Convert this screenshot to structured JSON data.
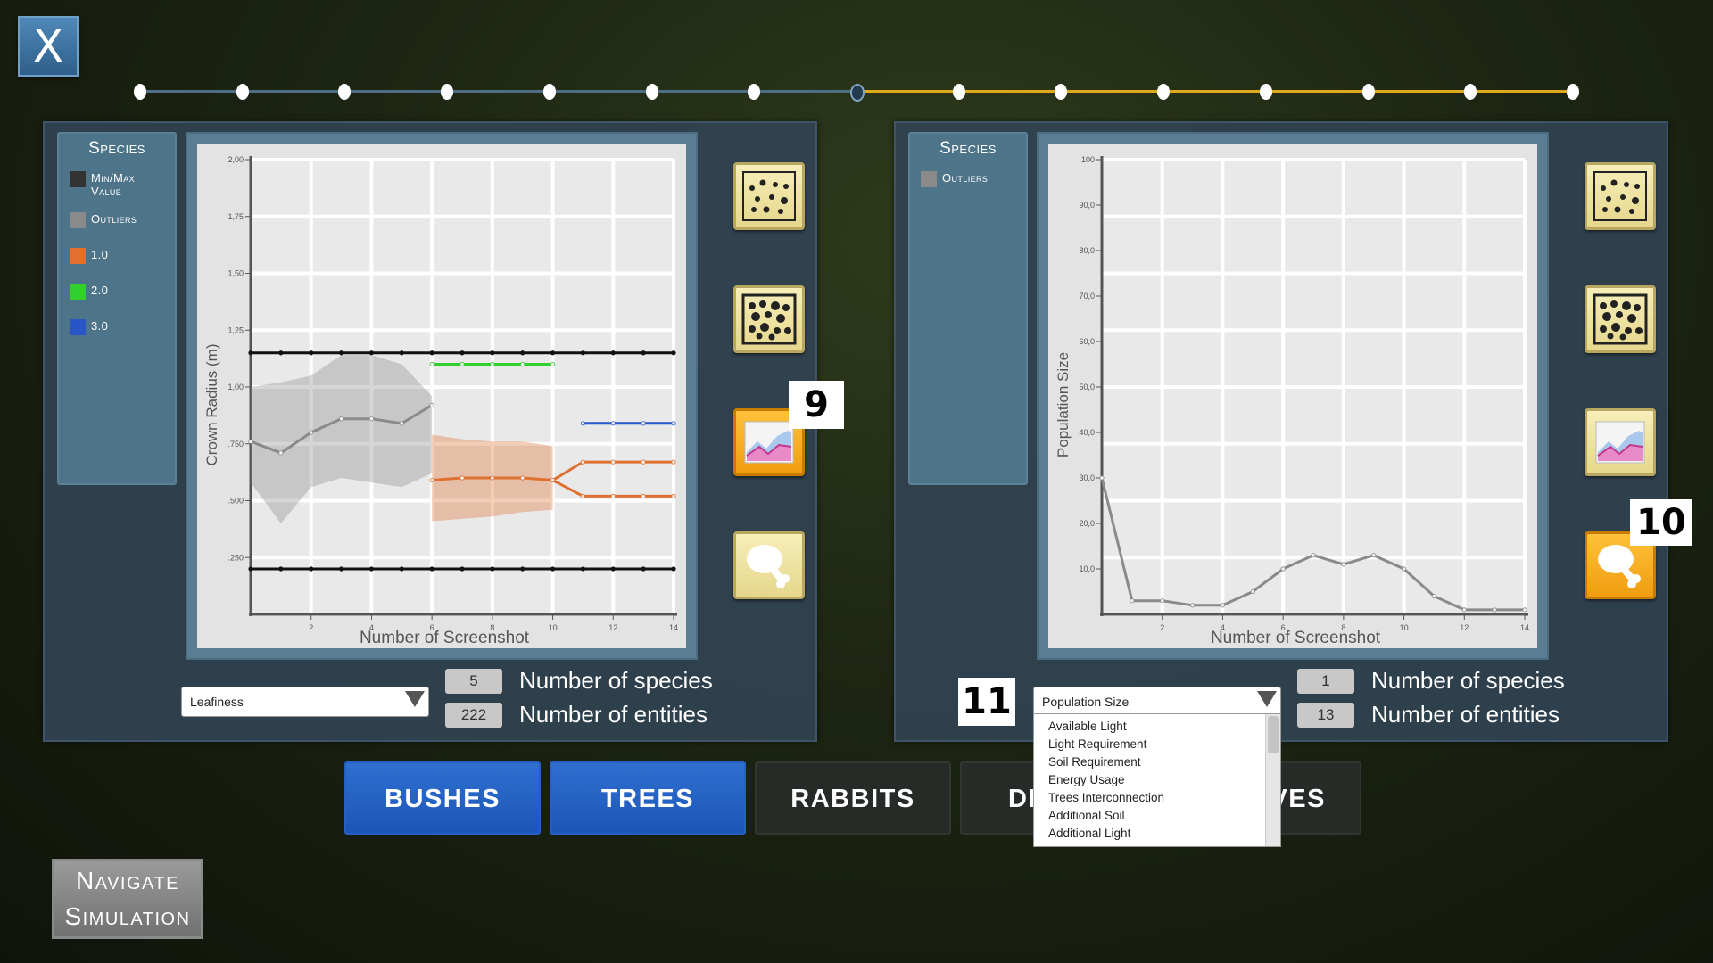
{
  "close_label": "X",
  "timeline": {
    "steps": 15,
    "current_index": 7,
    "past_color": "#4e6e86",
    "future_color": "#e0a81c"
  },
  "left_panel": {
    "legend": {
      "title": "Species",
      "items": [
        {
          "label": "Min/Max Value",
          "color": "#333333"
        },
        {
          "label": "Outliers",
          "color": "#8a8a8a"
        },
        {
          "label": "1.0",
          "color": "#e07030"
        },
        {
          "label": "2.0",
          "color": "#2fd02f"
        },
        {
          "label": "3.0",
          "color": "#2a55c8"
        }
      ]
    },
    "marker": "9",
    "dropdown_value": "Leafiness",
    "num_species": "5",
    "num_entities": "222",
    "species_label": "Number of species",
    "entities_label": "Number of entities"
  },
  "right_panel": {
    "legend": {
      "title": "Species",
      "items": [
        {
          "label": "Outliers",
          "color": "#8a8a8a"
        }
      ]
    },
    "marker_10": "10",
    "marker_11": "11",
    "dropdown_value": "Population Size",
    "dropdown_options": [
      "Available Light",
      "Light Requirement",
      "Soil Requirement",
      "Energy Usage",
      "Trees Interconnection",
      "Additional Soil",
      "Additional Light"
    ],
    "num_species": "1",
    "num_entities": "13",
    "species_label": "Number of species",
    "entities_label": "Number of entities"
  },
  "icons": [
    "sparse-dots-icon",
    "dense-dots-icon",
    "area-chart-icon",
    "drumstick-icon"
  ],
  "tabs": [
    {
      "label": "BUSHES",
      "active": true
    },
    {
      "label": "TREES",
      "active": true
    },
    {
      "label": "RABBITS",
      "active": false
    },
    {
      "label": "DI",
      "active": false
    },
    {
      "label": "VES",
      "active": false
    }
  ],
  "nav_button": {
    "line1": "Navigate",
    "line2": "Simulation"
  },
  "chart_data": [
    {
      "type": "line",
      "xlabel": "Number of Screenshot",
      "ylabel": "Crown Radius (m)",
      "xlim": [
        0,
        14
      ],
      "ylim": [
        0,
        2.0
      ],
      "xticks": [
        "2",
        "4",
        "6",
        "8",
        "10",
        "12",
        "14"
      ],
      "yticks": [
        ".250",
        ".500",
        ".750",
        "1,00",
        "1,25",
        "1,50",
        "1,75",
        "2,00"
      ],
      "series": [
        {
          "name": "Min/Max Value",
          "color": "#111111",
          "x": [
            0,
            1,
            2,
            3,
            4,
            5,
            6,
            7,
            8,
            9,
            10,
            11,
            12,
            13,
            14
          ],
          "y": [
            1.15,
            1.15,
            1.15,
            1.15,
            1.15,
            1.15,
            1.15,
            1.15,
            1.15,
            1.15,
            1.15,
            1.15,
            1.15,
            1.15,
            1.15
          ]
        },
        {
          "name": "Min/Max Value",
          "color": "#111111",
          "x": [
            0,
            1,
            2,
            3,
            4,
            5,
            6,
            7,
            8,
            9,
            10,
            11,
            12,
            13,
            14
          ],
          "y": [
            0.2,
            0.2,
            0.2,
            0.2,
            0.2,
            0.2,
            0.2,
            0.2,
            0.2,
            0.2,
            0.2,
            0.2,
            0.2,
            0.2,
            0.2
          ]
        },
        {
          "name": "Outliers",
          "color": "#8a8a8a",
          "x": [
            0,
            1,
            2,
            3,
            4,
            5,
            6
          ],
          "y": [
            0.76,
            0.71,
            0.8,
            0.86,
            0.86,
            0.84,
            0.92
          ],
          "band_low": [
            0.58,
            0.4,
            0.56,
            0.6,
            0.58,
            0.56,
            0.62
          ],
          "band_high": [
            1.0,
            1.02,
            1.05,
            1.14,
            1.14,
            1.1,
            0.96
          ]
        },
        {
          "name": "1.0",
          "color": "#e07030",
          "x": [
            6,
            7,
            8,
            9,
            10,
            11,
            12,
            13,
            14
          ],
          "y": [
            0.59,
            0.6,
            0.6,
            0.6,
            0.59,
            0.67,
            0.67,
            0.67,
            0.67
          ],
          "band_low": [
            0.41,
            0.42,
            0.43,
            0.45,
            0.46
          ],
          "band_high": [
            0.79,
            0.77,
            0.76,
            0.76,
            0.74
          ]
        },
        {
          "name": "1.0",
          "color": "#e07030",
          "x": [
            10,
            11,
            12,
            13,
            14
          ],
          "y": [
            0.59,
            0.52,
            0.52,
            0.52,
            0.52
          ]
        },
        {
          "name": "2.0",
          "color": "#2fd02f",
          "x": [
            6,
            7,
            8,
            9,
            10
          ],
          "y": [
            1.1,
            1.1,
            1.1,
            1.1,
            1.1
          ]
        },
        {
          "name": "3.0",
          "color": "#2a55c8",
          "x": [
            11,
            12,
            13,
            14
          ],
          "y": [
            0.84,
            0.84,
            0.84,
            0.84
          ]
        }
      ]
    },
    {
      "type": "line",
      "xlabel": "Number of Screenshot",
      "ylabel": "Population Size",
      "xlim": [
        0,
        14
      ],
      "ylim": [
        0,
        100
      ],
      "xticks": [
        "2",
        "4",
        "6",
        "8",
        "10",
        "12",
        "14"
      ],
      "yticks": [
        "10,0",
        "20,0",
        "30,0",
        "40,0",
        "50,0",
        "60,0",
        "70,0",
        "80,0",
        "90,0",
        "100"
      ],
      "series": [
        {
          "name": "Outliers",
          "color": "#8a8a8a",
          "x": [
            0,
            1,
            2,
            3,
            4,
            5,
            6,
            7,
            8,
            9,
            10,
            11,
            12,
            13,
            14
          ],
          "y": [
            30,
            3,
            3,
            2,
            2,
            5,
            10,
            13,
            11,
            13,
            10,
            4,
            1,
            1,
            1
          ]
        }
      ]
    }
  ]
}
